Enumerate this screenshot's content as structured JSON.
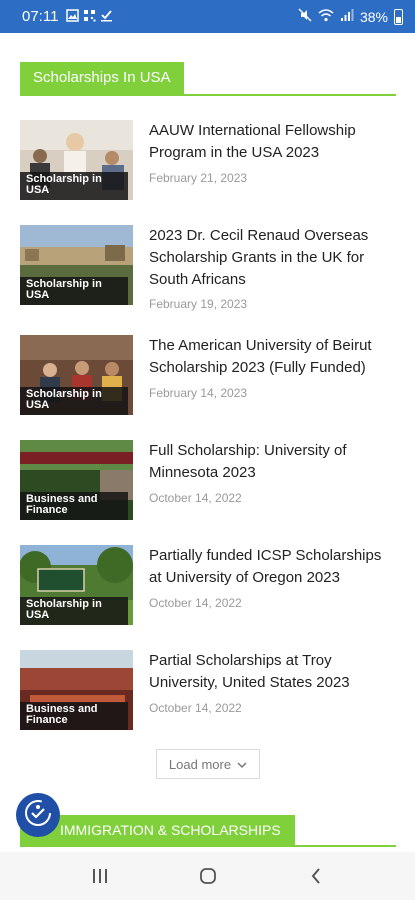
{
  "status_bar": {
    "time": "07:11",
    "battery": "38%",
    "left_icons": [
      "gallery-icon",
      "qr-icon",
      "download-icon"
    ],
    "right_icons": [
      "mute-icon",
      "wifi-icon",
      "signal-icon"
    ]
  },
  "section": {
    "title": "Scholarships In USA"
  },
  "articles": [
    {
      "category": "Scholarship in USA",
      "title": "AAUW International Fellowship Program in the USA 2023",
      "date": "February 21, 2023"
    },
    {
      "category": "Scholarship in USA",
      "title": "2023 Dr. Cecil Renaud Overseas Scholarship Grants in the UK for South Africans",
      "date": "February 19, 2023"
    },
    {
      "category": "Scholarship in USA",
      "title": "The American University of Beirut Scholarship 2023 (Fully Funded)",
      "date": "February 14, 2023"
    },
    {
      "category": "Business and Finance",
      "title": "Full Scholarship: University of Minnesota 2023",
      "date": "October 14, 2022"
    },
    {
      "category": "Scholarship in USA",
      "title": "Partially funded ICSP Scholarships at University of Oregon 2023",
      "date": "October 14, 2022"
    },
    {
      "category": "Business and Finance",
      "title": "Partial Scholarships at Troy University, United States 2023",
      "date": "October 14, 2022"
    }
  ],
  "load_more": {
    "label": "Load more"
  },
  "section2": {
    "title": "IMMIGRATION & SCHOLARSHIPS"
  },
  "colors": {
    "accent": "#7fd03b",
    "status_bar": "#2d6ec4",
    "fab": "#1f4fa6"
  }
}
